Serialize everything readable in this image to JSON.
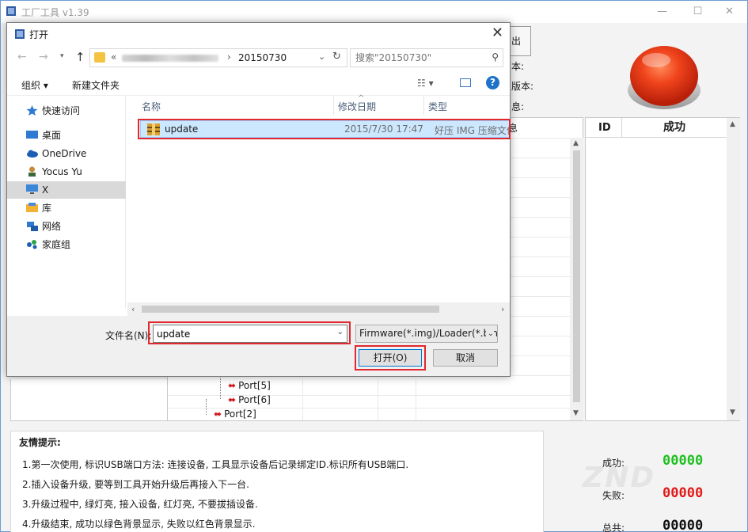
{
  "main_window": {
    "title": "工厂工具 v1.39",
    "top_button_label": "出",
    "info_labels": [
      "本:",
      "版本:",
      "息:"
    ],
    "grid_header_fragment": "息",
    "ports": [
      "Port[5]",
      "Port[6]",
      "Port[2]"
    ],
    "result_table": {
      "col_id": "ID",
      "col_success": "成功"
    },
    "tips": {
      "title": "友情提示:",
      "items": [
        "1.第一次使用, 标识USB端口方法: 连接设备, 工具显示设备后记录绑定ID.标识所有USB端口.",
        "2.插入设备升级, 要等到工具开始升级后再接入下一台.",
        "3.升级过程中, 绿灯亮, 接入设备, 红灯亮, 不要拔插设备.",
        "4.升级结束, 成功以绿色背景显示, 失败以红色背景显示."
      ]
    },
    "stats": {
      "success_label": "成功:",
      "success_value": "00000",
      "fail_label": "失败:",
      "fail_value": "00000",
      "total_label": "总共:",
      "total_value": "00000"
    },
    "watermark": "ZND"
  },
  "dialog": {
    "title": "打开",
    "address": {
      "chevron": "«",
      "path": "20150730"
    },
    "search": {
      "placeholder": "搜索\"20150730\""
    },
    "toolbar": {
      "organize": "组织 ▾",
      "new_folder": "新建文件夹"
    },
    "nav_items": [
      {
        "label": "快速访问",
        "icon": "star-icon"
      },
      {
        "label": "桌面",
        "icon": "desktop-icon"
      },
      {
        "label": "OneDrive",
        "icon": "onedrive-cloud-icon"
      },
      {
        "label": "Yocus Yu",
        "icon": "user-icon"
      },
      {
        "label": "X",
        "icon": "computer-icon"
      },
      {
        "label": "库",
        "icon": "library-icon"
      },
      {
        "label": "网络",
        "icon": "network-icon"
      },
      {
        "label": "家庭组",
        "icon": "homegroup-icon"
      }
    ],
    "columns": {
      "name": "名称",
      "modified": "修改日期",
      "type": "类型"
    },
    "file": {
      "name": "update",
      "modified": "2015/7/30 17:47",
      "type": "好压 IMG 压缩文件"
    },
    "filename_label": "文件名(N):",
    "filename_value": "update",
    "filetype_value": "Firmware(*.img)/Loader(*.bin)",
    "open_button": "打开(O)",
    "cancel_button": "取消"
  },
  "colors": {
    "accent_blue": "#0078d7",
    "highlight_red": "#e0282e",
    "success_green": "#1fc01f",
    "fail_red": "#e01a1a",
    "selection_blue": "#cce8ff"
  }
}
